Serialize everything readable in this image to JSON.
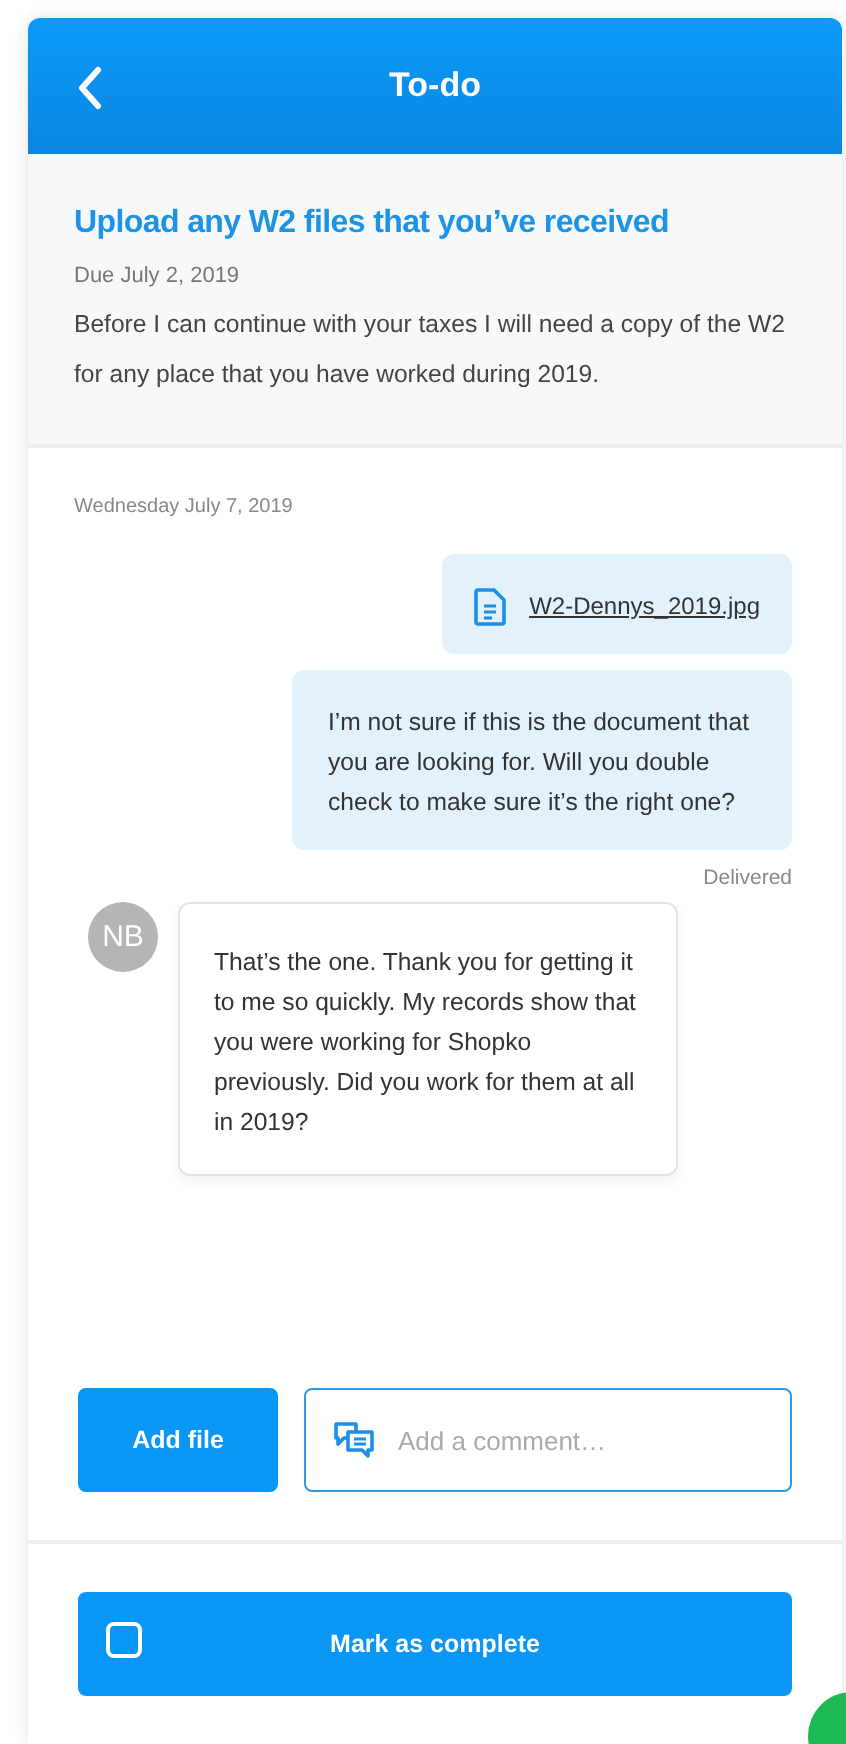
{
  "header": {
    "title": "To-do"
  },
  "task": {
    "title": "Upload any W2 files that you’ve received",
    "due": "Due July 2, 2019",
    "description": "Before I can continue with your taxes I will need a copy of the W2 for any place that you have worked during 2019."
  },
  "conversation": {
    "date": "Wednesday July 7, 2019",
    "messages": [
      {
        "kind": "file",
        "text": "W2-Dennys_2019.jpg"
      },
      {
        "kind": "sent",
        "text": "I’m not sure if this is the document that you are looking for. Will you double check to make sure it’s the right one?",
        "status": "Delivered"
      },
      {
        "kind": "received",
        "avatar": "NB",
        "text": "That’s the one. Thank you for getting it to me so quickly. My records show that you were working for Shopko previously. Did you work for them at all in 2019?"
      }
    ]
  },
  "composer": {
    "button": "Add file",
    "placeholder": "Add a comment…"
  },
  "complete": {
    "label": "Mark as complete",
    "checked": false
  }
}
